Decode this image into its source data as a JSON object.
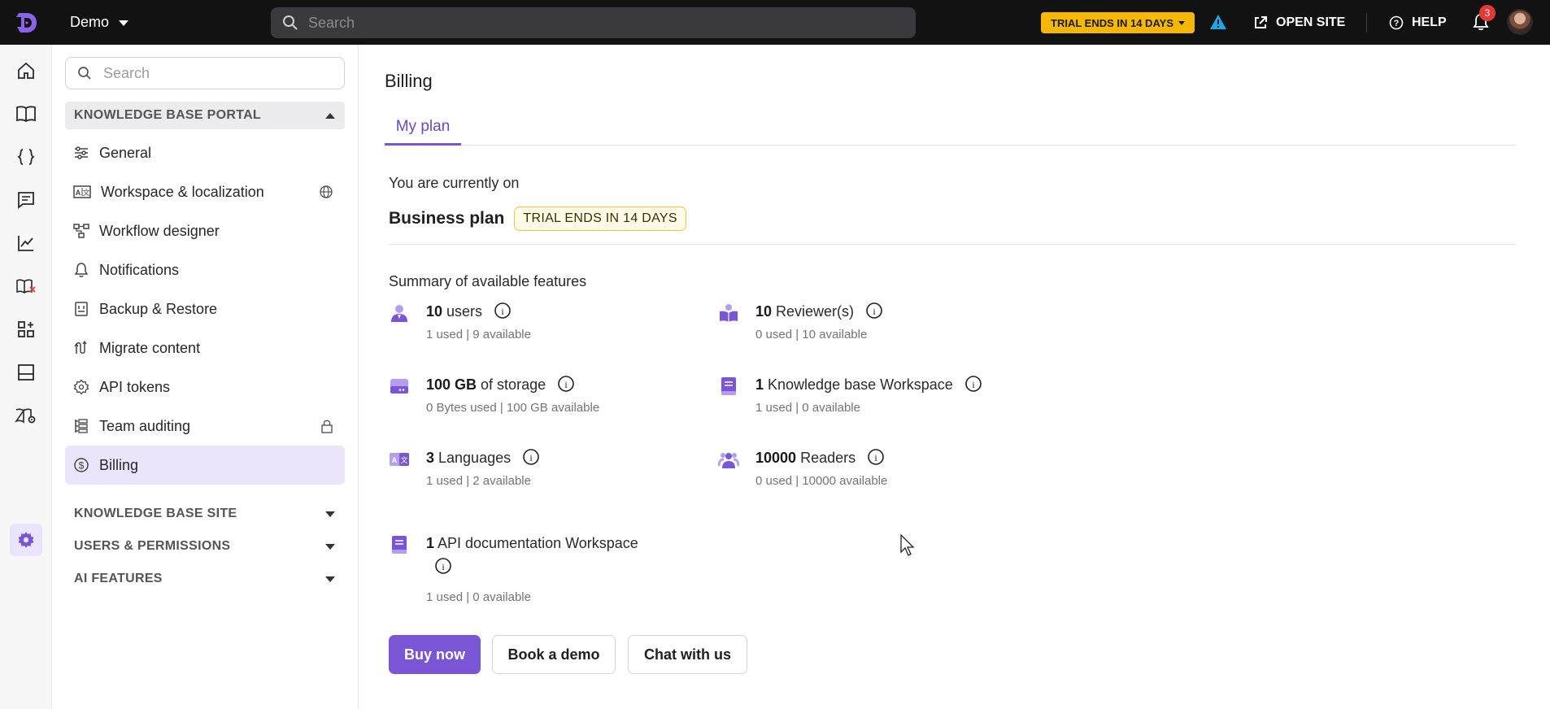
{
  "topbar": {
    "project": "Demo",
    "search_placeholder": "Search",
    "trial_button": "TRIAL ENDS IN 14 DAYS",
    "open_site": "OPEN SITE",
    "help": "HELP",
    "notification_count": "3"
  },
  "rail": {
    "icons": [
      "home-icon",
      "book-icon",
      "code-braces-icon",
      "comment-icon",
      "analytics-icon",
      "book-x-icon",
      "apps-icon",
      "layout-icon",
      "book-settings-icon",
      "gear-icon"
    ],
    "active": "gear-icon"
  },
  "sidebar": {
    "search_placeholder": "Search",
    "sections": {
      "portal": "KNOWLEDGE BASE PORTAL",
      "site": "KNOWLEDGE BASE SITE",
      "users": "USERS & PERMISSIONS",
      "ai": "AI FEATURES"
    },
    "items": [
      {
        "label": "General"
      },
      {
        "label": "Workspace & localization"
      },
      {
        "label": "Workflow designer"
      },
      {
        "label": "Notifications"
      },
      {
        "label": "Backup & Restore"
      },
      {
        "label": "Migrate content"
      },
      {
        "label": "API tokens"
      },
      {
        "label": "Team auditing"
      },
      {
        "label": "Billing"
      }
    ],
    "active_item": "Billing"
  },
  "main": {
    "title": "Billing",
    "tab": "My plan",
    "current_label": "You are currently on",
    "plan_name": "Business plan",
    "plan_badge": "TRIAL ENDS IN 14 DAYS",
    "summary_label": "Summary of available features",
    "features": [
      {
        "count": "10",
        "name": " users",
        "usage": "1 used | 9 available",
        "icon": "user-icon"
      },
      {
        "count": "10",
        "name": " Reviewer(s)",
        "usage": "0 used | 10 available",
        "icon": "reviewer-icon"
      },
      {
        "count": "100 GB",
        "name": " of storage",
        "usage": "0 Bytes used | 100 GB available",
        "icon": "storage-icon"
      },
      {
        "count": "1",
        "name": " Knowledge base Workspace",
        "usage": "1 used | 0 available",
        "icon": "workspace-book-icon"
      },
      {
        "count": "3",
        "name": " Languages",
        "usage": "1 used | 2 available",
        "icon": "language-icon"
      },
      {
        "count": "10000",
        "name": " Readers",
        "usage": "0 used | 10000 available",
        "icon": "readers-icon"
      },
      {
        "count": "1",
        "name": " API documentation Workspace",
        "usage": "1 used | 0 available",
        "icon": "api-book-icon"
      }
    ],
    "buttons": {
      "buy": "Buy now",
      "demo": "Book a demo",
      "chat": "Chat with us"
    }
  },
  "colors": {
    "accent": "#7a56d6",
    "topbar": "#121212",
    "trial": "#f5b700",
    "active_bg": "#ebe4fb",
    "warning": "#1aa7e8"
  }
}
